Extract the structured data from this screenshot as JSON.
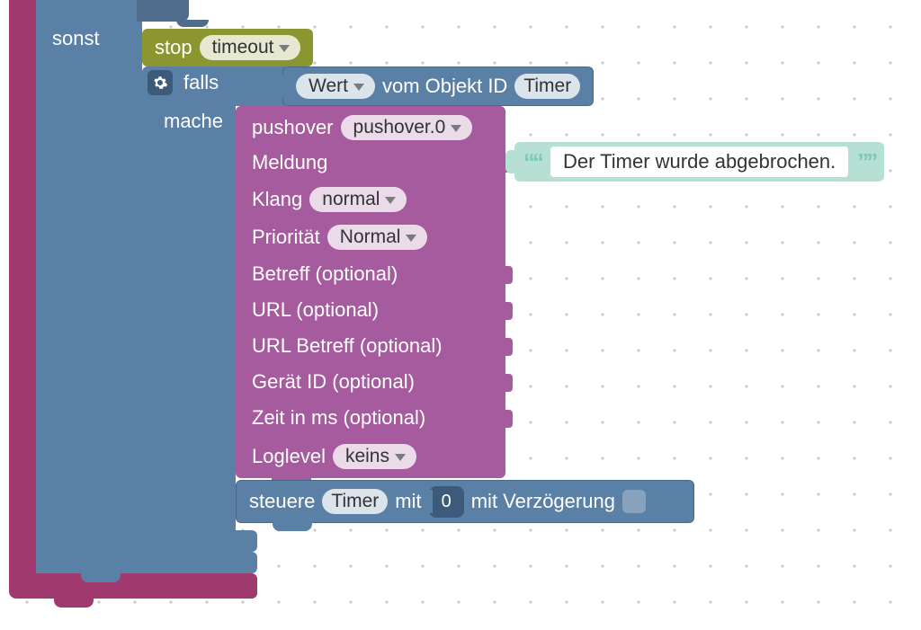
{
  "sonst_label": "sonst",
  "stop": {
    "label": "stop",
    "timer": "timeout"
  },
  "falls": {
    "label_falls": "falls",
    "label_mache": "mache",
    "wert_label": "Wert",
    "vom_label": "vom Objekt ID",
    "object_id": "Timer"
  },
  "pushover": {
    "header_label": "pushover",
    "instance": "pushover.0",
    "rows": {
      "meldung": "Meldung",
      "klang_label": "Klang",
      "klang_value": "normal",
      "prio_label": "Priorität",
      "prio_value": "Normal",
      "betreff": "Betreff (optional)",
      "url": "URL (optional)",
      "url_betreff": "URL Betreff (optional)",
      "device": "Gerät ID (optional)",
      "time": "Zeit in ms (optional)",
      "log_label": "Loglevel",
      "log_value": "keins"
    }
  },
  "meldung_text": "Der Timer wurde abgebrochen.",
  "steuere": {
    "label_steuere": "steuere",
    "object": "Timer",
    "label_mit": "mit",
    "value": "0",
    "label_delay": "mit Verzögerung"
  }
}
